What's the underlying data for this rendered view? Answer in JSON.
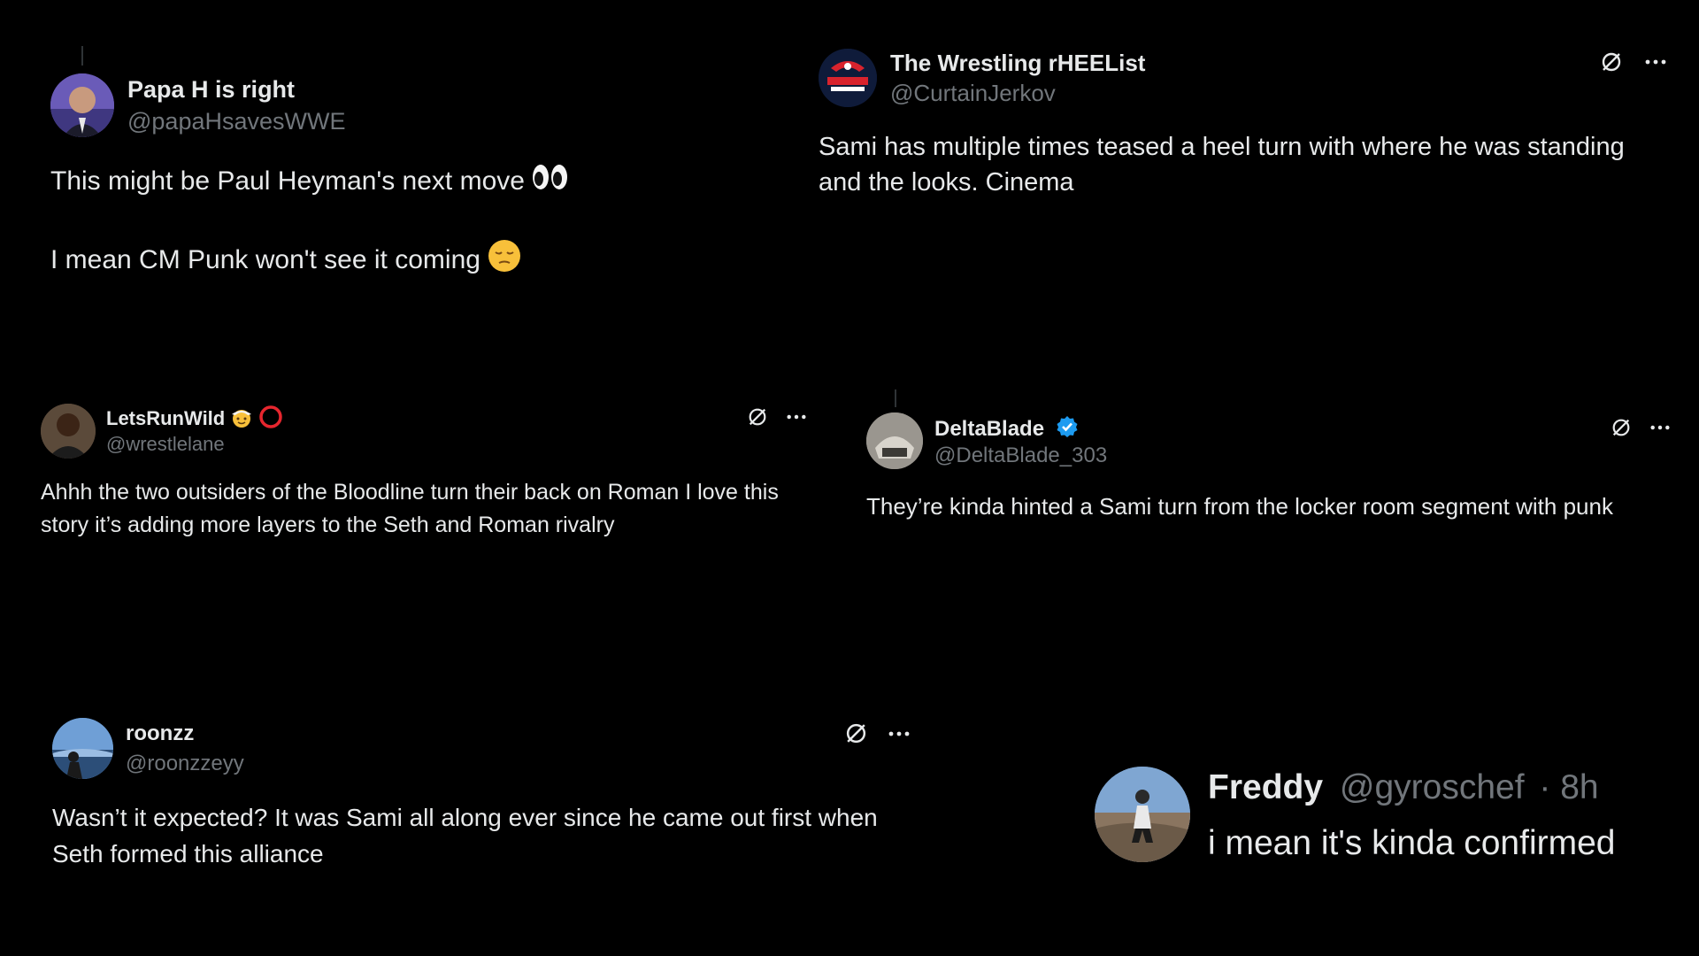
{
  "tweets": [
    {
      "name": "Papa H is right",
      "handle": "@papaHsavesWWE",
      "line1": "This might be Paul Heyman's next move",
      "line1_emoji": "eyes-emoji",
      "line2": "I mean CM Punk won't see it coming",
      "line2_emoji": "pensive-face-emoji",
      "avatar_icon": "profile-photo"
    },
    {
      "name": "The Wrestling rHEEList",
      "handle": "@CurtainJerkov",
      "text": "Sami has multiple times teased a heel turn with where he was standing and the looks.  Cinema",
      "avatar_icon": "hooked-deep-logo"
    },
    {
      "name": "LetsRunWild",
      "name_emojis": [
        "cowboy-face-emoji",
        "red-circle-emoji"
      ],
      "handle": "@wrestlelane",
      "text": "Ahhh the two outsiders of the Bloodline turn their back on Roman I love this story it’s adding more layers to the Seth and Roman rivalry",
      "avatar_icon": "profile-photo"
    },
    {
      "name": "DeltaBlade",
      "verified": true,
      "handle": "@DeltaBlade_303",
      "text": "They’re kinda hinted a Sami turn from the locker room segment with punk",
      "avatar_icon": "profile-photo"
    },
    {
      "name": "roonzz",
      "handle": "@roonzzeyy",
      "text": "Wasn’t it expected? It was Sami all along ever since he came out first when Seth formed this alliance",
      "avatar_icon": "profile-photo"
    },
    {
      "name": "Freddy",
      "handle": "@gyroschef",
      "time": "· 8h",
      "text": "i mean it's kinda confirmed",
      "avatar_icon": "profile-photo"
    }
  ],
  "icons": {
    "grok": "grok-icon",
    "more": "more-icon",
    "verified": "verified-badge-icon"
  },
  "colors": {
    "background": "#000000",
    "text": "#e7e9ea",
    "handle": "#71767b",
    "verified": "#1d9bf0"
  }
}
